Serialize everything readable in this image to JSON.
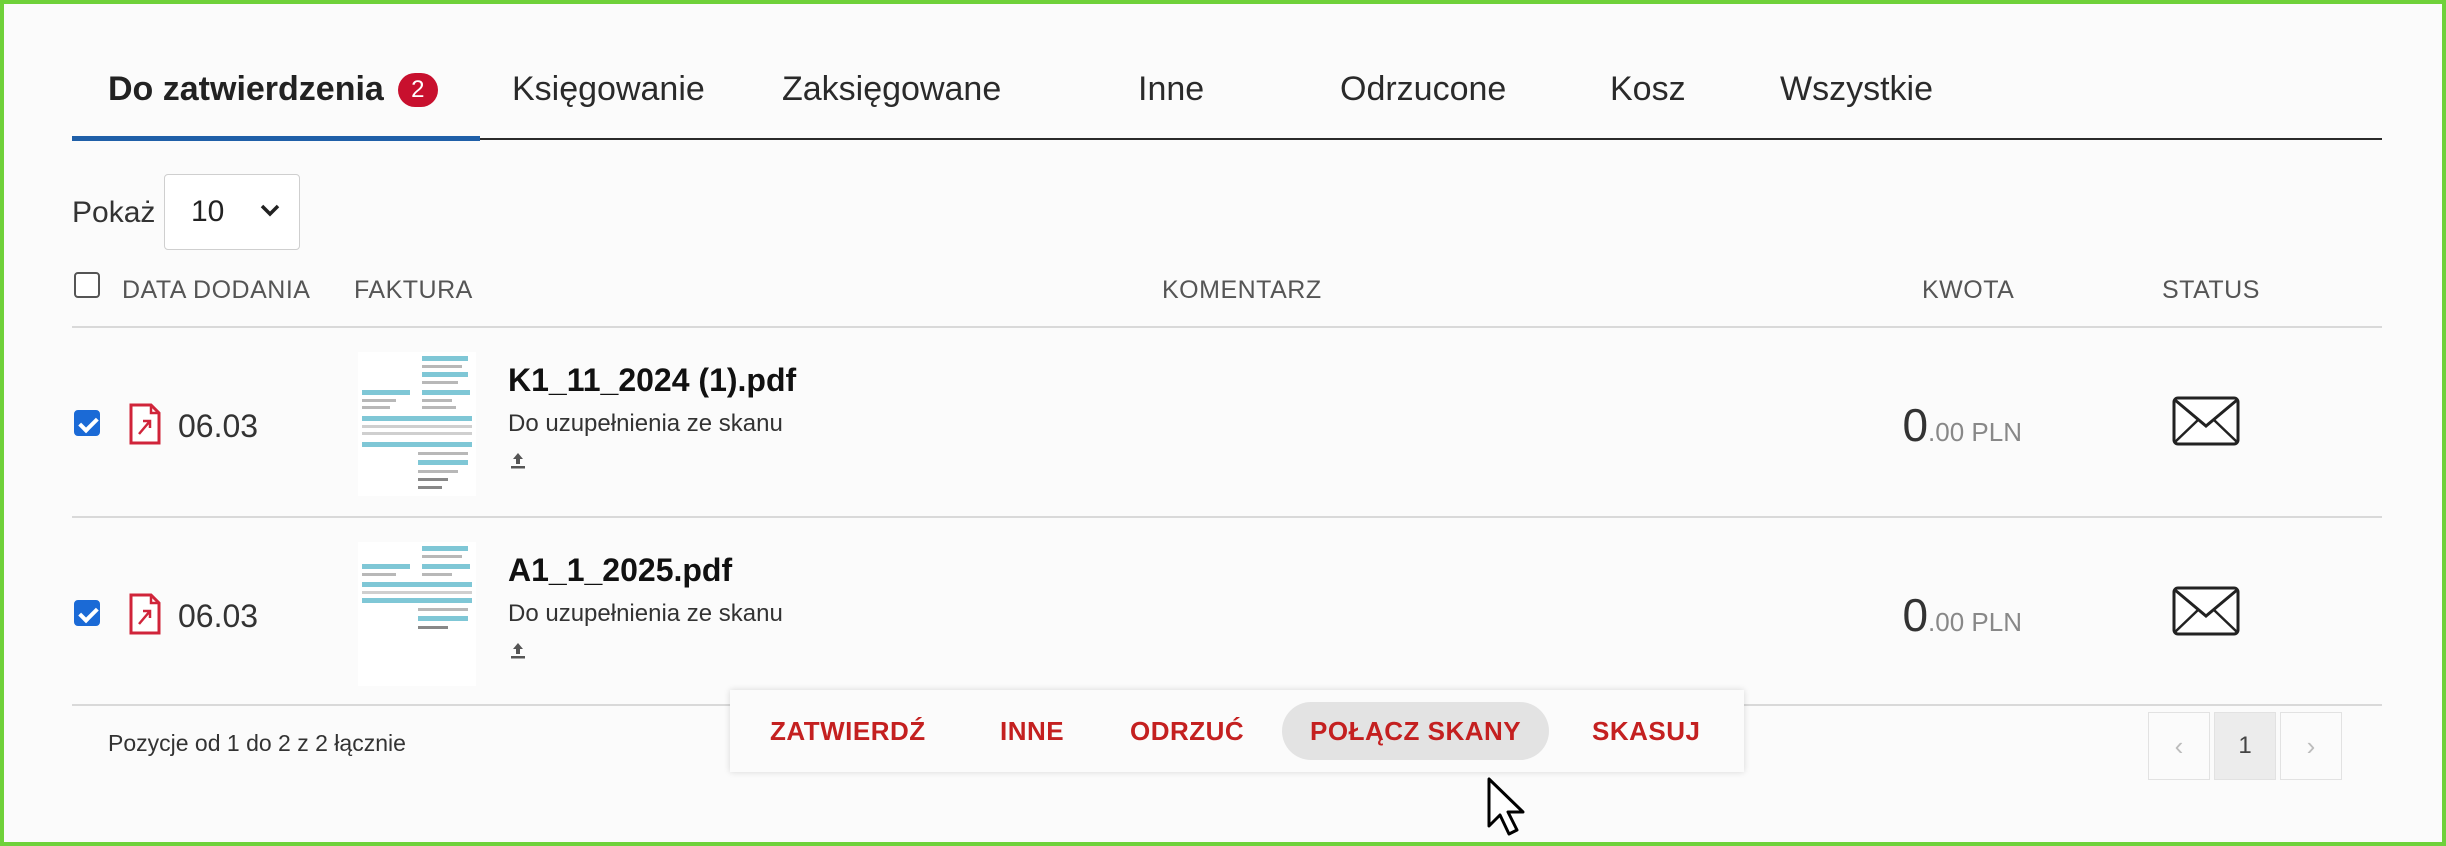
{
  "tabs": [
    {
      "label": "Do zatwierdzenia",
      "badge": "2",
      "active": true
    },
    {
      "label": "Księgowanie"
    },
    {
      "label": "Zaksięgowane"
    },
    {
      "label": "Inne"
    },
    {
      "label": "Odrzucone"
    },
    {
      "label": "Kosz"
    },
    {
      "label": "Wszystkie"
    }
  ],
  "show": {
    "label": "Pokaż",
    "value": "10"
  },
  "columns": {
    "date": "DATA DODANIA",
    "invoice": "FAKTURA",
    "comment": "KOMENTARZ",
    "amount": "KWOTA",
    "status": "STATUS"
  },
  "rows": [
    {
      "checked": true,
      "date": "06.03",
      "filename": "K1_11_2024 (1).pdf",
      "subtitle": "Do uzupełnienia ze skanu",
      "amount_int": "0",
      "amount_dec": ".00 PLN",
      "status_icon": "envelope-icon"
    },
    {
      "checked": true,
      "date": "06.03",
      "filename": "A1_1_2025.pdf",
      "subtitle": "Do uzupełnienia ze skanu",
      "amount_int": "0",
      "amount_dec": ".00 PLN",
      "status_icon": "envelope-icon"
    }
  ],
  "footer": {
    "info": "Pozycje od 1 do 2 z 2 łącznie"
  },
  "actions": [
    "ZATWIERDŹ",
    "INNE",
    "ODRZUĆ",
    "POŁĄCZ SKANY",
    "SKASUJ"
  ],
  "pagination": {
    "prev": "‹",
    "current": "1",
    "next": "›"
  },
  "colors": {
    "accent": "#1f5fa8",
    "badge": "#c8102e",
    "action": "#c42020",
    "frame": "#6fd13a"
  }
}
